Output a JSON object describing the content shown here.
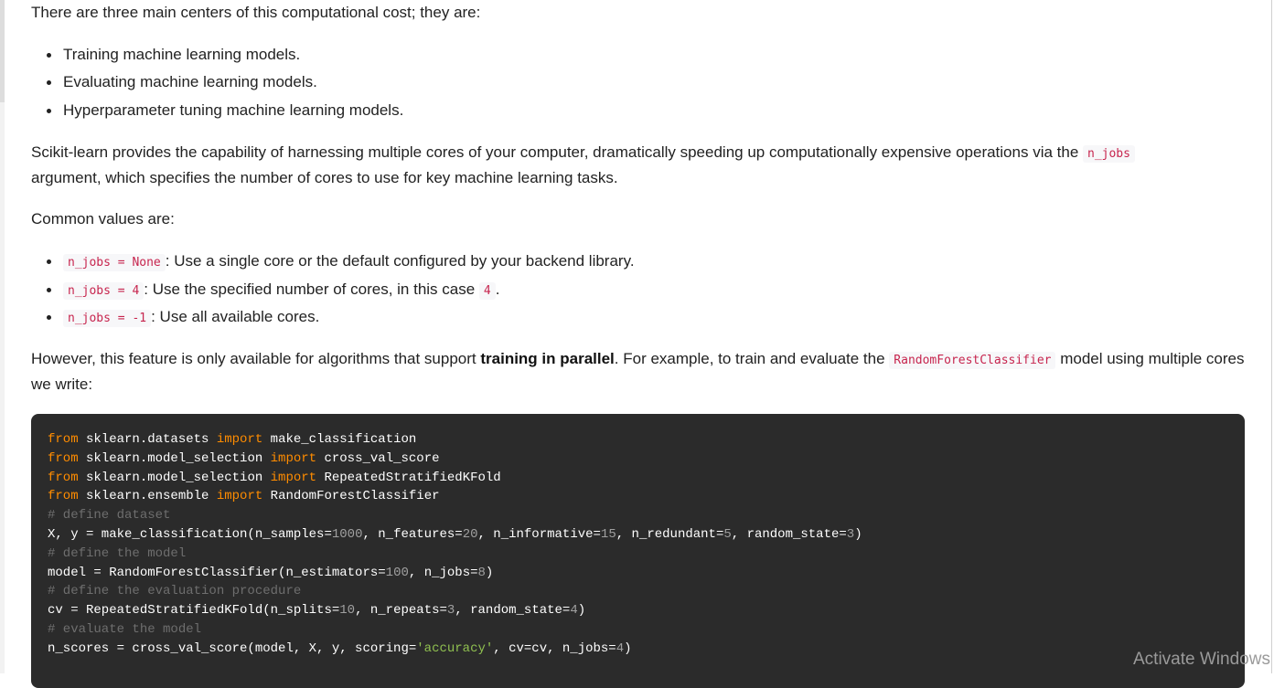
{
  "article": {
    "intro": "There are three main centers of this computational cost; they are:",
    "cost_centers": [
      "Training machine learning models.",
      "Evaluating machine learning models.",
      "Hyperparameter tuning machine learning models."
    ],
    "scikit_para": {
      "before": "Scikit-learn provides the capability of harnessing multiple cores of your computer, dramatically speeding up computationally expensive operations via the ",
      "code": "n_jobs",
      "after": " argument, which specifies the number of cores to use for key machine learning tasks."
    },
    "common_values": "Common values are:",
    "values": [
      {
        "code": "n_jobs = None",
        "text": ": Use a single core or the default configured by your backend library."
      },
      {
        "code": "n_jobs = 4",
        "text": ": Use the specified number of cores, in this case ",
        "code2": "4",
        "tail": "."
      },
      {
        "code": "n_jobs = -1",
        "text": ": Use all available cores."
      }
    ],
    "parallel_para": {
      "before": "However, this feature is only available for algorithms that support ",
      "bold": "training in parallel",
      "middle": ". For example, to train and evaluate the ",
      "code": "RandomForestClassifier",
      "after": " model using multiple cores we write:"
    }
  },
  "code": {
    "kw_from": "from",
    "kw_import": "import",
    "mod_datasets": " sklearn.datasets ",
    "fn_make_classification": " make_classification",
    "mod_model_selection": " sklearn.model_selection ",
    "fn_cross_val_score": " cross_val_score",
    "fn_repeated": " RepeatedStratifiedKFold",
    "mod_ensemble": " sklearn.ensemble ",
    "fn_rfc": " RandomForestClassifier",
    "c_define_dataset": "# define dataset",
    "l_dataset_a": "X, y = make_classification(n_samples=",
    "n_1000": "1000",
    "l_dataset_b": ", n_features=",
    "n_20": "20",
    "l_dataset_c": ", n_informative=",
    "n_15": "15",
    "l_dataset_d": ", n_redundant=",
    "n_5": "5",
    "l_dataset_e": ", random_state=",
    "n_3a": "3",
    "close_paren": ")",
    "c_define_model": "# define the model",
    "l_model_a": "model = RandomForestClassifier(n_estimators=",
    "n_100": "100",
    "l_model_b": ", n_jobs=",
    "n_8": "8",
    "c_define_eval": "# define the evaluation procedure",
    "l_cv_a": "cv = RepeatedStratifiedKFold(n_splits=",
    "n_10": "10",
    "l_cv_b": ", n_repeats=",
    "n_3b": "3",
    "l_cv_c": ", random_state=",
    "n_4a": "4",
    "c_evaluate": "# evaluate the model",
    "l_scores_a": "n_scores = cross_val_score(model, X, y, scoring=",
    "s_accuracy": "'accuracy'",
    "l_scores_b": ", cv=cv, n_jobs=",
    "n_4b": "4"
  },
  "watermark": "Activate Windows"
}
